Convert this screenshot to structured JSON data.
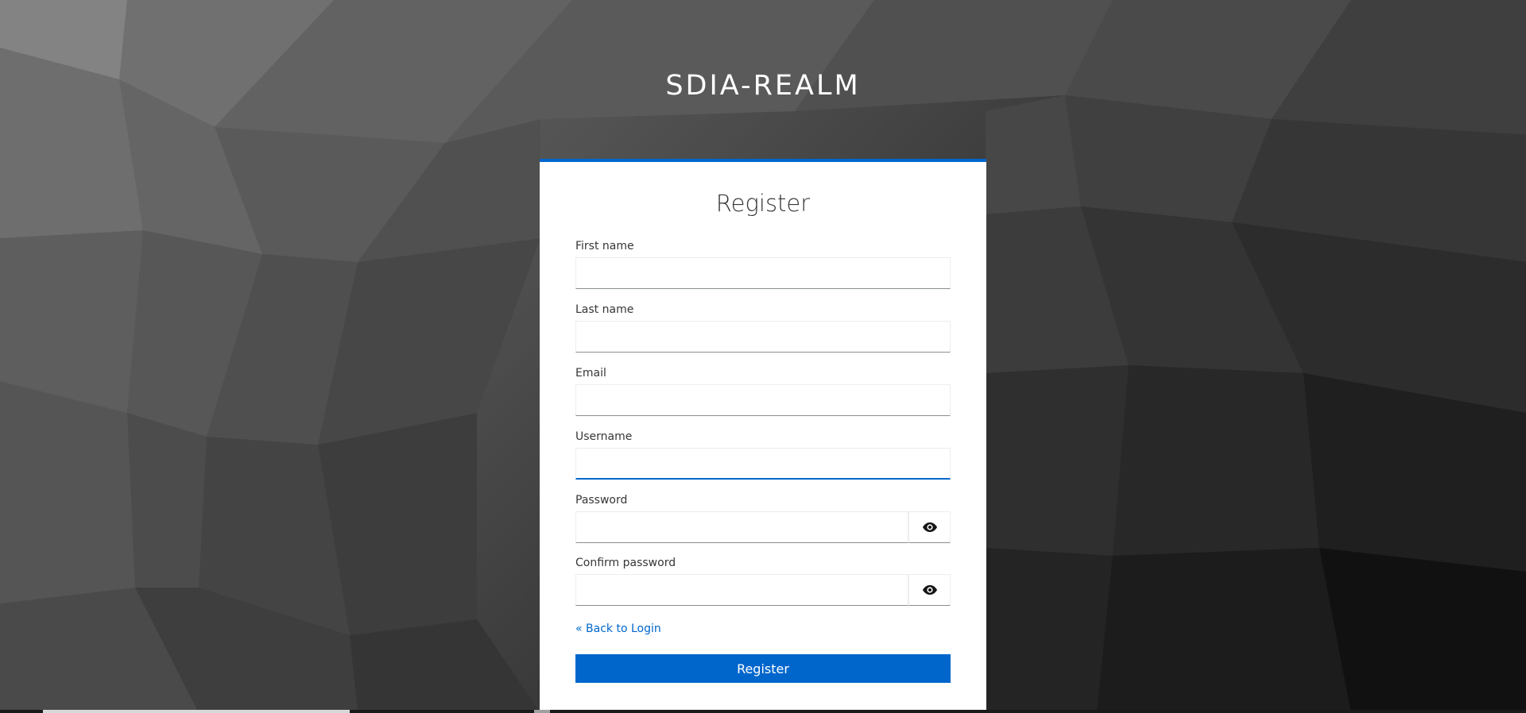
{
  "realm": {
    "title": "SDIA-REALM"
  },
  "form": {
    "title": "Register",
    "fields": [
      {
        "label": "First name",
        "value": "",
        "placeholder": ""
      },
      {
        "label": "Last name",
        "value": "",
        "placeholder": ""
      },
      {
        "label": "Email",
        "value": "",
        "placeholder": ""
      },
      {
        "label": "Username",
        "value": "",
        "placeholder": ""
      },
      {
        "label": "Password",
        "value": "",
        "placeholder": ""
      },
      {
        "label": "Confirm password",
        "value": "",
        "placeholder": ""
      }
    ],
    "back_link": "« Back to Login",
    "submit_label": "Register"
  },
  "icons": {
    "password_toggle": "eye-icon",
    "confirm_toggle": "eye-icon"
  },
  "colors": {
    "accent": "#0066cc",
    "card_bg": "#ffffff",
    "text": "#363636"
  }
}
